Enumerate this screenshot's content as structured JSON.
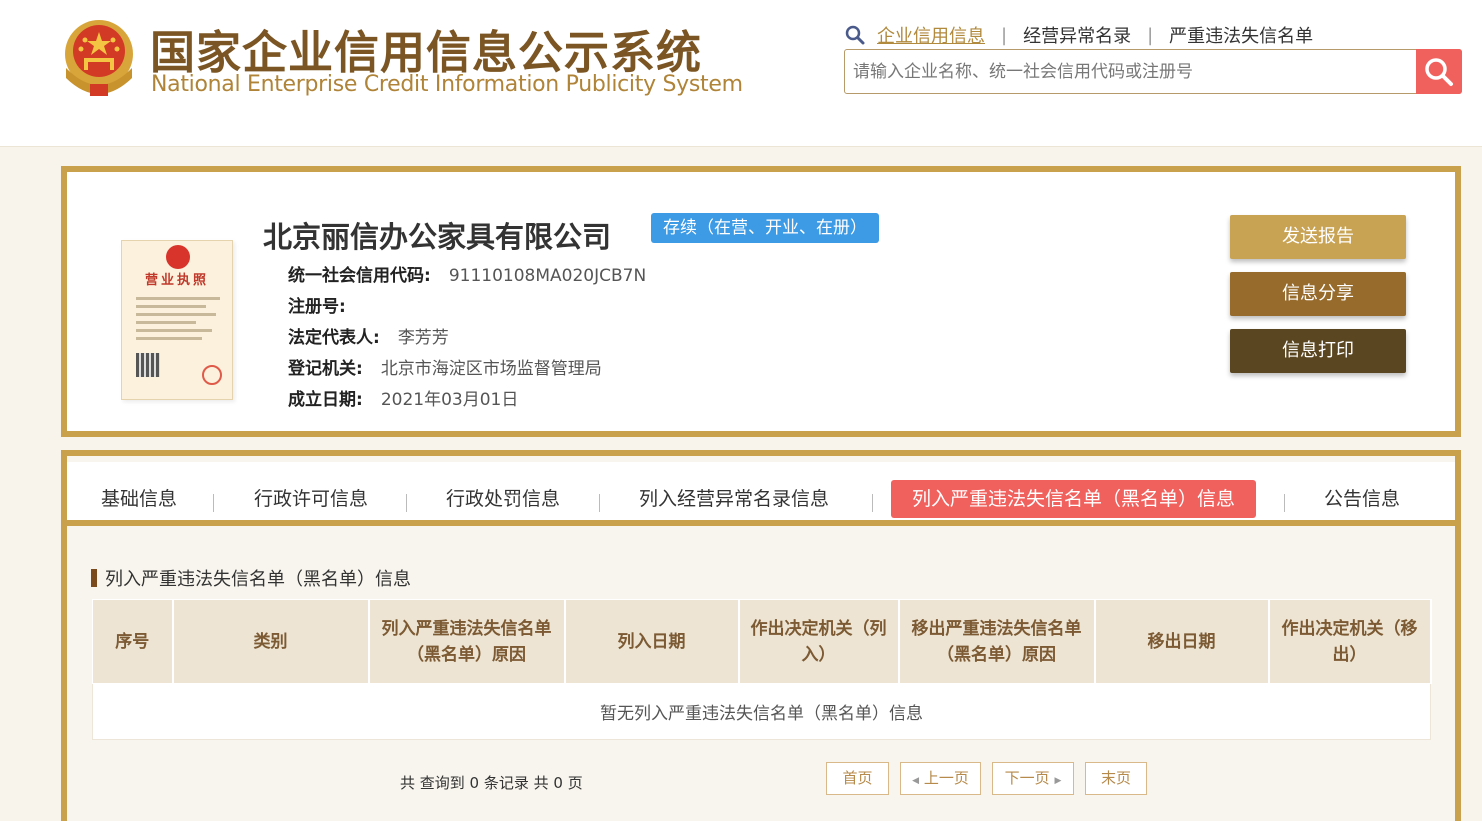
{
  "header": {
    "title_cn": "国家企业信用信息公示系统",
    "title_en": "National Enterprise Credit Information Publicity System",
    "links": [
      "企业信用信息",
      "经营异常名录",
      "严重违法失信名单"
    ],
    "search_placeholder": "请输入企业名称、统一社会信用代码或注册号"
  },
  "company": {
    "name": "北京丽信办公家具有限公司",
    "status": "存续（在营、开业、在册）",
    "license_title": "营业执照",
    "fields": [
      {
        "label": "统一社会信用代码:",
        "value": "91110108MA020JCB7N"
      },
      {
        "label": "注册号:",
        "value": ""
      },
      {
        "label": "法定代表人:",
        "value": "李芳芳"
      },
      {
        "label": "登记机关:",
        "value": "北京市海淀区市场监督管理局"
      },
      {
        "label": "成立日期:",
        "value": "2021年03月01日"
      }
    ],
    "buttons": {
      "send": "发送报告",
      "share": "信息分享",
      "print": "信息打印"
    }
  },
  "tabs": [
    "基础信息",
    "行政许可信息",
    "行政处罚信息",
    "列入经营异常名录信息",
    "列入严重违法失信名单（黑名单）信息",
    "公告信息"
  ],
  "active_tab": 4,
  "section": {
    "title": "列入严重违法失信名单（黑名单）信息",
    "columns": [
      "序号",
      "类别",
      "列入严重违法失信名单（黑名单）原因",
      "列入日期",
      "作出决定机关（列入）",
      "移出严重违法失信名单（黑名单）原因",
      "移出日期",
      "作出决定机关（移出）"
    ],
    "empty_text": "暂无列入严重违法失信名单（黑名单）信息",
    "record_count": "共 查询到 0 条记录 共 0 页"
  },
  "pagination": {
    "first": "首页",
    "prev": "上一页",
    "next": "下一页",
    "last": "末页"
  },
  "colors": {
    "gold": "#c9a04c",
    "accent_red": "#f0615e",
    "status_blue": "#3d9ae5",
    "brown_dark": "#5a4620"
  }
}
